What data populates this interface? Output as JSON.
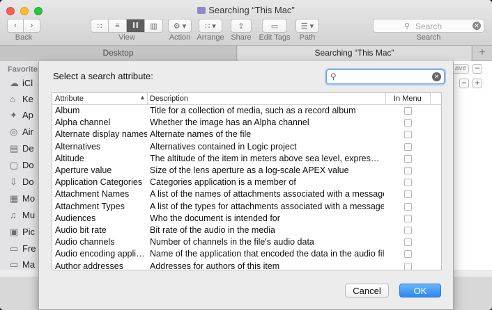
{
  "window": {
    "title": "Searching “This Mac”"
  },
  "toolbar": {
    "back_label": "Back",
    "view_label": "View",
    "action_label": "Action",
    "arrange_label": "Arrange",
    "share_label": "Share",
    "edit_tags_label": "Edit Tags",
    "path_label": "Path",
    "search_label": "Search",
    "search_placeholder": "Search"
  },
  "tabs": [
    {
      "label": "Desktop"
    },
    {
      "label": "Searching “This Mac”"
    }
  ],
  "sidebar": {
    "header": "Favorites",
    "items": [
      {
        "label": "iCl",
        "icon": "cloud-icon"
      },
      {
        "label": "Ke",
        "icon": "home-icon"
      },
      {
        "label": "Ap",
        "icon": "applications-icon"
      },
      {
        "label": "Air",
        "icon": "airdrop-icon"
      },
      {
        "label": "De",
        "icon": "desktop-icon"
      },
      {
        "label": "Do",
        "icon": "documents-icon"
      },
      {
        "label": "Do",
        "icon": "downloads-icon"
      },
      {
        "label": "Mo",
        "icon": "movies-icon"
      },
      {
        "label": "Mu",
        "icon": "music-icon"
      },
      {
        "label": "Pic",
        "icon": "pictures-icon"
      },
      {
        "label": "Fre",
        "icon": "folder-icon"
      },
      {
        "label": "Ma",
        "icon": "folder-icon"
      }
    ]
  },
  "background": {
    "save_label": "ave"
  },
  "dialog": {
    "prompt": "Select a search attribute:",
    "search_value": "",
    "columns": {
      "attribute": "Attribute",
      "description": "Description",
      "in_menu": "In Menu"
    },
    "rows": [
      {
        "attribute": "Album",
        "description": "Title for a collection of media, such as a record album"
      },
      {
        "attribute": "Alpha channel",
        "description": "Whether the image has an Alpha channel"
      },
      {
        "attribute": "Alternate display names",
        "description": "Alternate names of the file"
      },
      {
        "attribute": "Alternatives",
        "description": "Alternatives contained in Logic project"
      },
      {
        "attribute": "Altitude",
        "description": "The altitude of the item in meters above sea level, expres…"
      },
      {
        "attribute": "Aperture value",
        "description": "Size of the lens aperture as a log-scale APEX value"
      },
      {
        "attribute": "Application Categories",
        "description": "Categories application is a member of"
      },
      {
        "attribute": "Attachment Names",
        "description": "A list of the names of attachments associated with a message"
      },
      {
        "attribute": "Attachment Types",
        "description": "A list of the types for attachments associated with a message"
      },
      {
        "attribute": "Audiences",
        "description": "Who the document is intended for"
      },
      {
        "attribute": "Audio bit rate",
        "description": "Bit rate of the audio in the media"
      },
      {
        "attribute": "Audio channels",
        "description": "Number of channels in the file's audio data"
      },
      {
        "attribute": "Audio encoding appli…",
        "description": "Name of the application that encoded the data in the audio file"
      },
      {
        "attribute": "Author addresses",
        "description": "Addresses for authors of this item"
      }
    ],
    "cancel_label": "Cancel",
    "ok_label": "OK"
  },
  "colors": {
    "accent": "#2c88f0",
    "close": "#fc5f57",
    "minimize": "#fdbc2e",
    "maximize": "#29c73f"
  }
}
